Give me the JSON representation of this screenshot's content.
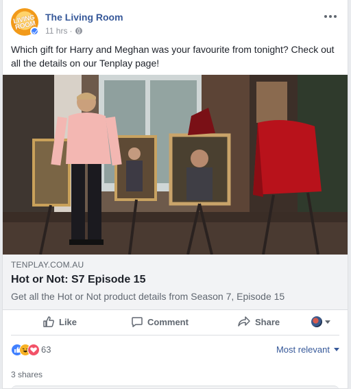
{
  "page": {
    "name": "The Living Room",
    "time": "11 hrs",
    "separator": "·",
    "logo_text_line1": "LIVING",
    "logo_text_line2": "ROOM"
  },
  "caption": "Which gift for Harry and Meghan was your favourite from tonight? Check out all the details on our Tenplay page!",
  "link": {
    "domain": "TENPLAY.COM.AU",
    "title": "Hot or Not: S7 Episode 15",
    "description": "Get all the Hot or Not product details from Season 7, Episode 15"
  },
  "actions": {
    "like": "Like",
    "comment": "Comment",
    "share": "Share"
  },
  "reactions": {
    "count": "63",
    "sort": "Most relevant"
  },
  "shares": "3 shares",
  "colors": {
    "brand_blue": "#365899",
    "like_blue": "#4080ff",
    "love_red": "#f25268",
    "haha_yellow": "#f7b125"
  },
  "icons": [
    "more-options-icon",
    "globe-icon",
    "like-icon",
    "comment-icon",
    "share-icon",
    "verified-badge-icon"
  ]
}
